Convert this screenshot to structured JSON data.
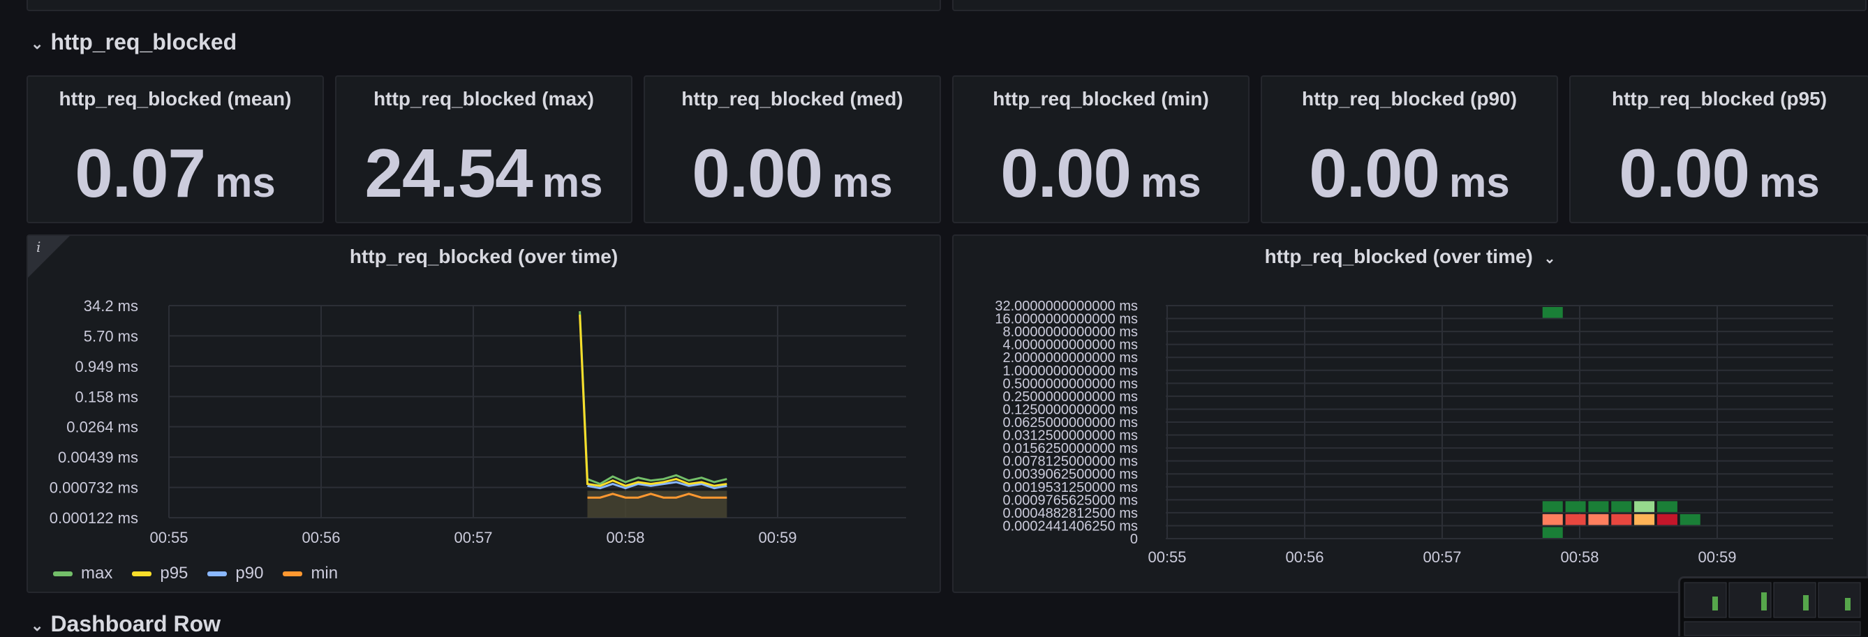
{
  "rows": {
    "blocked_title": "http_req_blocked",
    "next_title": "Dashboard Row"
  },
  "stats": [
    {
      "title": "http_req_blocked (mean)",
      "value": "0.07",
      "unit": "ms"
    },
    {
      "title": "http_req_blocked (max)",
      "value": "24.54",
      "unit": "ms"
    },
    {
      "title": "http_req_blocked (med)",
      "value": "0.00",
      "unit": "ms"
    },
    {
      "title": "http_req_blocked (min)",
      "value": "0.00",
      "unit": "ms"
    },
    {
      "title": "http_req_blocked (p90)",
      "value": "0.00",
      "unit": "ms"
    },
    {
      "title": "http_req_blocked (p95)",
      "value": "0.00",
      "unit": "ms"
    }
  ],
  "timeseries_panel": {
    "title": "http_req_blocked (over time)",
    "info_icon": "info-icon"
  },
  "heatmap_panel": {
    "title": "http_req_blocked (over time)",
    "menu_icon": "chevron-down-icon"
  },
  "colors": {
    "max": "#73bf69",
    "p95": "#fade2a",
    "p90": "#8ab8ff",
    "min": "#ff9830",
    "grid": "#2c2f36",
    "axis_text": "#ccccdc"
  },
  "chart_data": [
    {
      "type": "line",
      "title": "http_req_blocked (over time)",
      "xlabel": "",
      "ylabel": "",
      "x_ticks": [
        "00:55",
        "00:56",
        "00:57",
        "00:58",
        "00:59"
      ],
      "y_ticks": [
        "0.000122 ms",
        "0.000732 ms",
        "0.00439 ms",
        "0.0264 ms",
        "0.158 ms",
        "0.949 ms",
        "5.70 ms",
        "34.2 ms"
      ],
      "y_scale": "log",
      "ylim_ms": [
        0.000122,
        34.2
      ],
      "grid": true,
      "legend_placement": "bottom-left",
      "series": [
        {
          "name": "max",
          "color": "#73bf69",
          "points": [
            [
              "00:57:42",
              24.5
            ],
            [
              "00:57:45",
              0.0012
            ],
            [
              "00:57:50",
              0.0009
            ],
            [
              "00:57:55",
              0.0014
            ],
            [
              "00:58:00",
              0.001
            ],
            [
              "00:58:05",
              0.0013
            ],
            [
              "00:58:10",
              0.0011
            ],
            [
              "00:58:15",
              0.0012
            ],
            [
              "00:58:20",
              0.0015
            ],
            [
              "00:58:25",
              0.0011
            ],
            [
              "00:58:30",
              0.0013
            ],
            [
              "00:58:35",
              0.001
            ],
            [
              "00:58:40",
              0.0012
            ]
          ]
        },
        {
          "name": "p95",
          "color": "#fade2a",
          "points": [
            [
              "00:57:42",
              20.0
            ],
            [
              "00:57:45",
              0.0009
            ],
            [
              "00:57:50",
              0.0008
            ],
            [
              "00:57:55",
              0.0011
            ],
            [
              "00:58:00",
              0.0008
            ],
            [
              "00:58:05",
              0.001
            ],
            [
              "00:58:10",
              0.0009
            ],
            [
              "00:58:15",
              0.001
            ],
            [
              "00:58:20",
              0.0012
            ],
            [
              "00:58:25",
              0.0009
            ],
            [
              "00:58:30",
              0.001
            ],
            [
              "00:58:35",
              0.0008
            ],
            [
              "00:58:40",
              0.0009
            ]
          ]
        },
        {
          "name": "p90",
          "color": "#8ab8ff",
          "points": [
            [
              "00:57:45",
              0.0008
            ],
            [
              "00:57:50",
              0.0007
            ],
            [
              "00:57:55",
              0.0009
            ],
            [
              "00:58:00",
              0.0007
            ],
            [
              "00:58:05",
              0.0009
            ],
            [
              "00:58:10",
              0.0008
            ],
            [
              "00:58:15",
              0.0009
            ],
            [
              "00:58:20",
              0.001
            ],
            [
              "00:58:25",
              0.0008
            ],
            [
              "00:58:30",
              0.0009
            ],
            [
              "00:58:35",
              0.0007
            ],
            [
              "00:58:40",
              0.0008
            ]
          ]
        },
        {
          "name": "min",
          "color": "#ff9830",
          "points": [
            [
              "00:57:45",
              0.0004
            ],
            [
              "00:57:50",
              0.0004
            ],
            [
              "00:57:55",
              0.0005
            ],
            [
              "00:58:00",
              0.0004
            ],
            [
              "00:58:05",
              0.0004
            ],
            [
              "00:58:10",
              0.0005
            ],
            [
              "00:58:15",
              0.0004
            ],
            [
              "00:58:20",
              0.0004
            ],
            [
              "00:58:25",
              0.0005
            ],
            [
              "00:58:30",
              0.0004
            ],
            [
              "00:58:35",
              0.0004
            ],
            [
              "00:58:40",
              0.0004
            ]
          ]
        }
      ]
    },
    {
      "type": "heatmap",
      "title": "http_req_blocked (over time)",
      "x_ticks": [
        "00:55",
        "00:56",
        "00:57",
        "00:58",
        "00:59"
      ],
      "y_ticks": [
        "0",
        "0.0002441406250 ms",
        "0.0004882812500 ms",
        "0.0009765625000 ms",
        "0.0019531250000 ms",
        "0.0039062500000 ms",
        "0.0078125000000 ms",
        "0.0156250000000 ms",
        "0.0312500000000 ms",
        "0.0625000000000 ms",
        "0.1250000000000 ms",
        "0.2500000000000 ms",
        "0.5000000000000 ms",
        "1.0000000000000 ms",
        "2.0000000000000 ms",
        "4.0000000000000 ms",
        "8.0000000000000 ms",
        "16.0000000000000 ms",
        "32.0000000000000 ms"
      ],
      "grid": true,
      "cells": [
        {
          "time": "00:57:45",
          "bucket": 17,
          "color": "#1a7f37"
        },
        {
          "time": "00:57:45",
          "bucket": 2,
          "color": "#1a7f37"
        },
        {
          "time": "00:57:55",
          "bucket": 2,
          "color": "#1a7f37"
        },
        {
          "time": "00:58:05",
          "bucket": 2,
          "color": "#1a7f37"
        },
        {
          "time": "00:58:15",
          "bucket": 2,
          "color": "#1a7f37"
        },
        {
          "time": "00:58:25",
          "bucket": 2,
          "color": "#96d98d"
        },
        {
          "time": "00:58:35",
          "bucket": 2,
          "color": "#1a7f37"
        },
        {
          "time": "00:57:45",
          "bucket": 1,
          "color": "#ff7f5e"
        },
        {
          "time": "00:57:55",
          "bucket": 1,
          "color": "#e8473f"
        },
        {
          "time": "00:58:05",
          "bucket": 1,
          "color": "#ff7f5e"
        },
        {
          "time": "00:58:15",
          "bucket": 1,
          "color": "#e8473f"
        },
        {
          "time": "00:58:25",
          "bucket": 1,
          "color": "#ffb357"
        },
        {
          "time": "00:58:35",
          "bucket": 1,
          "color": "#c4162a"
        },
        {
          "time": "00:58:45",
          "bucket": 1,
          "color": "#1a7f37"
        },
        {
          "time": "00:57:45",
          "bucket": 0,
          "color": "#1a7f37"
        }
      ]
    }
  ]
}
